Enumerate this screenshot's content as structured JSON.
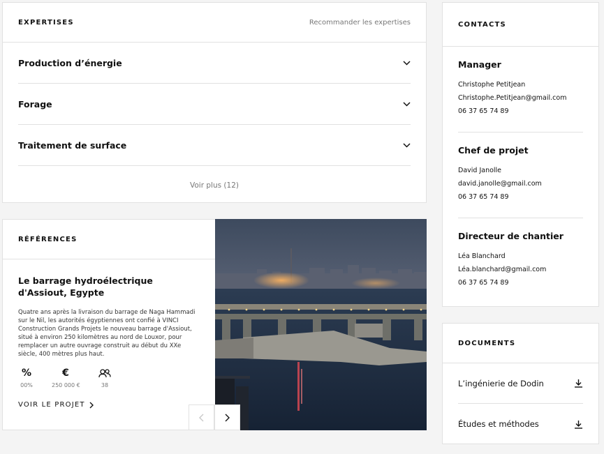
{
  "expertises": {
    "title": "EXPERTISES",
    "recommend_link": "Recommander les expertises",
    "items": [
      {
        "label": "Production d’énergie",
        "icon": "chevron-down-icon"
      },
      {
        "label": "Forage",
        "icon": "chevron-down-icon"
      },
      {
        "label": "Traitement de surface",
        "icon": "chevron-down-icon"
      }
    ],
    "see_more": "Voir plus (12)"
  },
  "references": {
    "title": "RÉFÉRENCES",
    "project_title": "Le barrage hydroélectrique d'Assiout, Egypte",
    "description": "Quatre ans après la livraison du barrage de Naga Hammadi sur le Nil, les autorités égyptiennes ont confié à VINCI Construction Grands Projets le nouveau barrage d'Assiout, situé à environ 250 kilomètres au nord de Louxor, pour remplacer un autre ouvrage construit au début du XXe siècle, 400 mètres plus haut.",
    "stats": [
      {
        "icon": "percent-icon",
        "glyph": "%",
        "value": "00%"
      },
      {
        "icon": "euro-icon",
        "glyph": "€",
        "value": "250 000 €"
      },
      {
        "icon": "people-icon",
        "glyph": "",
        "value": "38"
      }
    ],
    "project_link": "VOIR LE PROJET",
    "image_alt": "Barrage d'Assiout de nuit"
  },
  "contacts": {
    "title": "CONTACTS",
    "people": [
      {
        "role": "Manager",
        "name": "Christophe Petitjean",
        "email": "Christophe.Petitjean@gmail.com",
        "phone": "06 37 65 74 89"
      },
      {
        "role": "Chef de projet",
        "name": "David Janolle",
        "email": "david.janolle@gmail.com",
        "phone": "06 37 65 74 89"
      },
      {
        "role": "Directeur de chantier",
        "name": "Léa Blanchard",
        "email": "Léa.blanchard@gmail.com",
        "phone": "06 37 65 74 89"
      }
    ]
  },
  "documents": {
    "title": "DOCUMENTS",
    "items": [
      {
        "label": "L’ingénierie de Dodin",
        "icon": "download-icon"
      },
      {
        "label": "Études et méthodes",
        "icon": "download-icon"
      }
    ]
  },
  "colors": {
    "background": "#f4f4f4",
    "card": "#ffffff",
    "border": "#e1e1e1",
    "muted": "#777777",
    "text": "#111111"
  }
}
